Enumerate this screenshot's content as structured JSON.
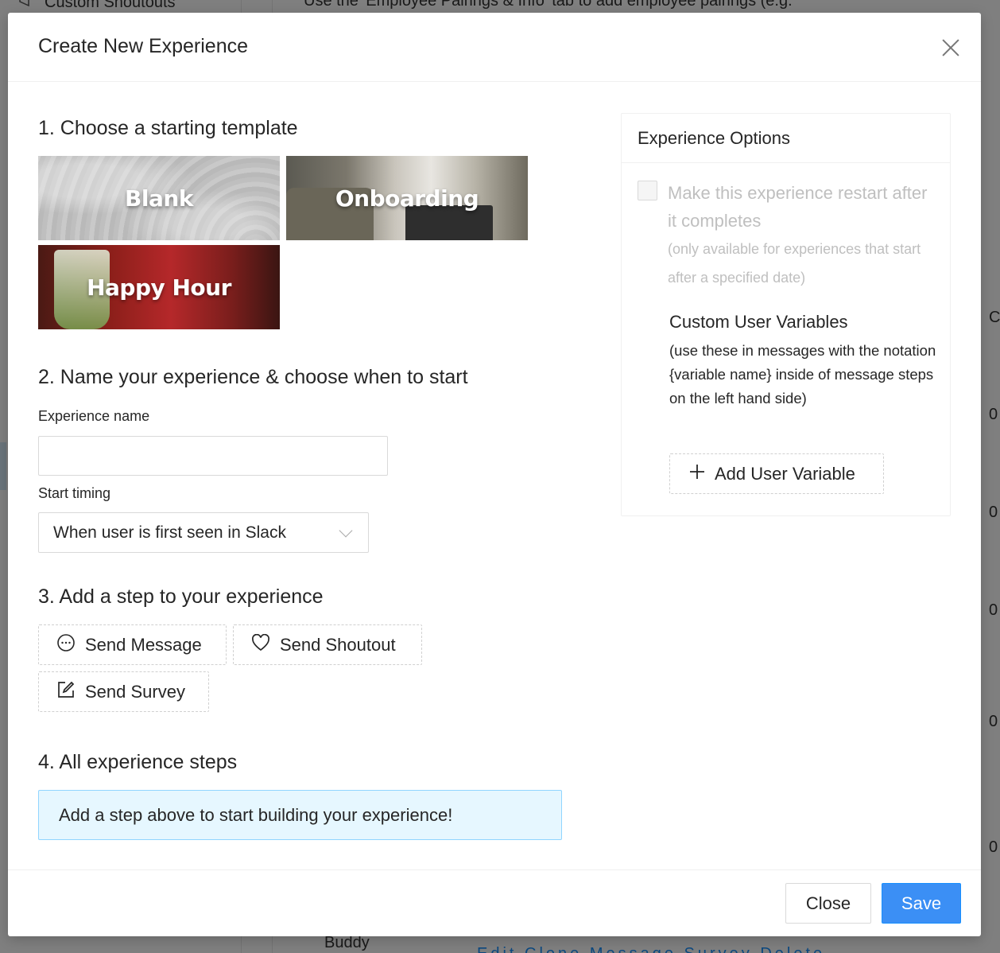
{
  "background": {
    "sidebar_item": "Custom Shoutouts",
    "hint": "Use the 'Employee Pairings & Info' tab to add employee pairings (e.g.",
    "bottom_text": "Buddy",
    "bottom_links": "Edit Clone Message Survey Delete",
    "right_cells": [
      "C",
      "0",
      "0",
      "0",
      "0",
      "0"
    ]
  },
  "modal": {
    "title": "Create New Experience",
    "section1": {
      "title": "1. Choose a starting template",
      "templates": [
        {
          "label": "Blank"
        },
        {
          "label": "Onboarding"
        },
        {
          "label": "Happy Hour"
        }
      ]
    },
    "section2": {
      "title": "2. Name your experience & choose when to start",
      "name_label": "Experience name",
      "name_value": "",
      "name_placeholder": "",
      "timing_label": "Start timing",
      "timing_value": "When user is first seen in Slack"
    },
    "section3": {
      "title": "3. Add a step to your experience",
      "buttons": {
        "message": "Send Message",
        "shoutout": "Send Shoutout",
        "survey": "Send Survey"
      }
    },
    "section4": {
      "title": "4. All experience steps",
      "empty_text": "Add a step above to start building your experience!"
    },
    "options": {
      "title": "Experience Options",
      "restart_label": "Make this experience restart after it completes",
      "restart_checked": false,
      "restart_note": "(only available for experiences that start after a specified date)",
      "variables_title": "Custom User Variables",
      "variables_desc": "(use these in messages with the notation {variable name} inside of message steps on the left hand side)",
      "add_variable_label": "Add User Variable"
    },
    "footer": {
      "close_label": "Close",
      "save_label": "Save"
    }
  },
  "colors": {
    "primary": "#3b8ff5",
    "info_bg": "#e6f7ff",
    "info_border": "#91d5ff"
  }
}
